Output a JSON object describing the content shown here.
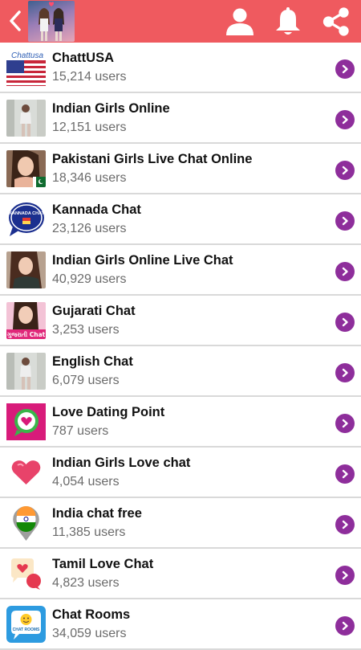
{
  "header": {
    "back_icon": "chevron-left-icon",
    "logo": "app-logo-two-girls",
    "actions": [
      "person-icon",
      "bell-icon",
      "share-icon"
    ],
    "color": "#ef5a5f"
  },
  "accent": "#8e2e9b",
  "rooms": [
    {
      "name": "ChattUSA",
      "users": "15,214 users",
      "thumb": "us-flag",
      "thumb_text": "Chattusa"
    },
    {
      "name": "Indian Girls Online",
      "users": "12,151 users",
      "thumb": "girl-photo"
    },
    {
      "name": "Pakistani Girls Live Chat Online",
      "users": "18,346 users",
      "thumb": "pakistan-girl"
    },
    {
      "name": "Kannada Chat",
      "users": "23,126 users",
      "thumb": "kannada-bubble",
      "thumb_text": "KANNADA CHAT"
    },
    {
      "name": "Indian Girls Online Live Chat",
      "users": "40,929 users",
      "thumb": "girl-photo-2"
    },
    {
      "name": "Gujarati Chat",
      "users": "3,253 users",
      "thumb": "gujarati-girl",
      "thumb_text": "ગુજરાતી Chat"
    },
    {
      "name": "English Chat",
      "users": "6,079 users",
      "thumb": "girl-photo"
    },
    {
      "name": "Love Dating Point",
      "users": "787 users",
      "thumb": "love-chat-icon"
    },
    {
      "name": "Indian Girls Love chat",
      "users": "4,054 users",
      "thumb": "heart-icon"
    },
    {
      "name": "India chat free",
      "users": "11,385 users",
      "thumb": "india-pin-icon"
    },
    {
      "name": "Tamil Love Chat",
      "users": "4,823 users",
      "thumb": "love-bubbles-icon"
    },
    {
      "name": "Chat Rooms",
      "users": "34,059 users",
      "thumb": "chat-rooms-icon",
      "thumb_text": "CHAT ROOMS"
    }
  ]
}
